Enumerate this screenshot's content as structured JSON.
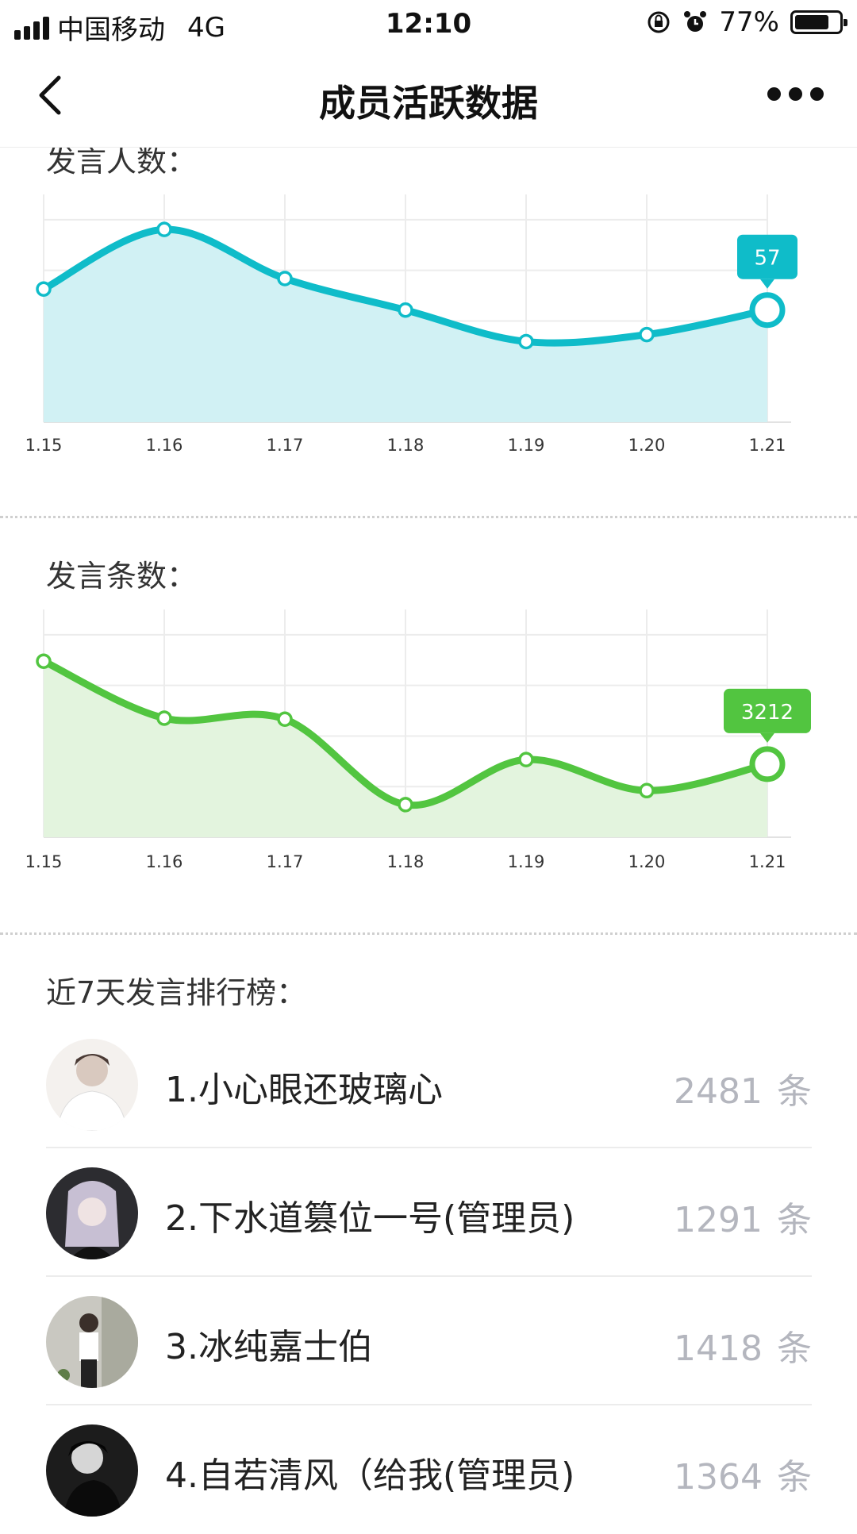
{
  "status_bar": {
    "carrier": "中国移动",
    "network": "4G",
    "time": "12:10",
    "battery": "77%",
    "battery_level": 0.77
  },
  "nav": {
    "title": "成员活跃数据",
    "back_icon": "chevron-left-icon",
    "more_icon": "more-dots-icon"
  },
  "sections": {
    "speakers_title": "发言人数：",
    "messages_title": "发言条数：",
    "ranking_title": "近7天发言排行榜："
  },
  "chart_data": [
    {
      "type": "area",
      "title": "发言人数：",
      "x": [
        "1.15",
        "1.16",
        "1.17",
        "1.18",
        "1.19",
        "1.20",
        "1.21"
      ],
      "values": [
        63,
        80,
        66,
        57,
        48,
        50,
        57
      ],
      "ylim": [
        25,
        90
      ],
      "grid": true,
      "highlight_label": "57",
      "color": "#0fbcc9",
      "fill": "#d1f1f4"
    },
    {
      "type": "area",
      "title": "发言条数：",
      "x": [
        "1.15",
        "1.16",
        "1.17",
        "1.18",
        "1.19",
        "1.20",
        "1.21"
      ],
      "values": [
        5200,
        4100,
        4080,
        2430,
        3300,
        2700,
        3212
      ],
      "ylim": [
        1800,
        6200
      ],
      "grid": true,
      "highlight_label": "3212",
      "color": "#52c540",
      "fill": "#e3f4de"
    }
  ],
  "ranking": {
    "unit": "条",
    "items": [
      {
        "name": "1.小心眼还玻璃心",
        "count": "2481",
        "avatar": "avatar-white-shirt"
      },
      {
        "name": "2.下水道篡位一号(管理员)",
        "count": "1291",
        "avatar": "avatar-anime-girl"
      },
      {
        "name": "3.冰纯嘉士伯",
        "count": "1418",
        "avatar": "avatar-mirror-selfie"
      },
      {
        "name": "4.自若清风（给我(管理员)",
        "count": "1364",
        "avatar": "avatar-dark-portrait"
      }
    ]
  }
}
